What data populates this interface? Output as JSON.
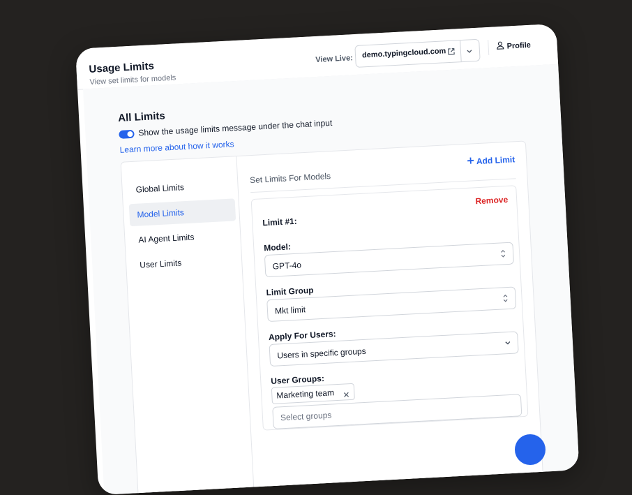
{
  "header": {
    "title": "Usage Limits",
    "subtitle": "View set limits for models",
    "view_live_label": "View Live:",
    "view_live_url": "demo.typingcloud.com",
    "profile_label": "Profile"
  },
  "limits": {
    "title": "All Limits",
    "toggle_label": "Show the usage limits message under the chat input",
    "toggle_on": true,
    "learn_more": "Learn more about how it works"
  },
  "sidebar": {
    "items": [
      {
        "label": "Global Limits",
        "active": false
      },
      {
        "label": "Model Limits",
        "active": true
      },
      {
        "label": "AI Agent Limits",
        "active": false
      },
      {
        "label": "User Limits",
        "active": false
      }
    ]
  },
  "main": {
    "title": "Set Limits For Models",
    "add_button": "Add Limit",
    "card": {
      "title": "Limit #1:",
      "remove_label": "Remove",
      "model_label": "Model:",
      "model_value": "GPT-4o",
      "group_label": "Limit Group",
      "group_value": "Mkt limit",
      "apply_label": "Apply For Users:",
      "apply_value": "Users in specific groups",
      "user_groups_label": "User Groups:",
      "user_groups": [
        "Marketing team"
      ],
      "groups_placeholder": "Select groups"
    }
  },
  "colors": {
    "accent": "#2563eb",
    "danger": "#dc2626",
    "background": "#242220"
  }
}
